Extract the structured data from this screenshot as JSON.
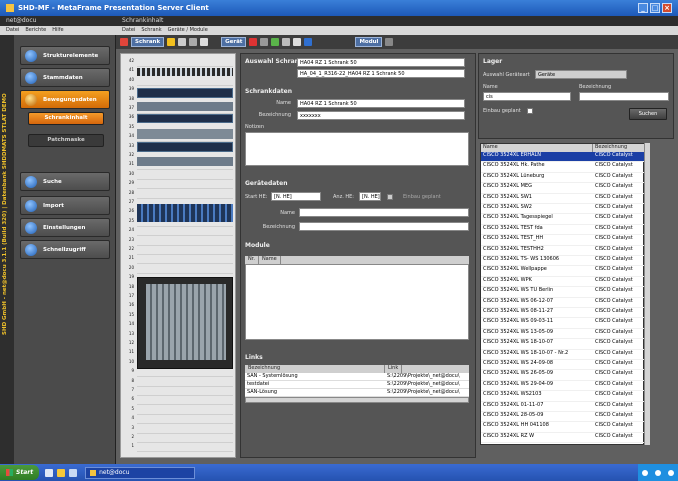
{
  "window": {
    "title": "SHD-MF - MetaFrame Presentation Server Client",
    "left_app_title": "net@docu",
    "left_menu": [
      "Datei",
      "Berichte",
      "Hilfe"
    ],
    "main_title": "Schrankinhalt",
    "main_menu": [
      "Datei",
      "Schrank",
      "Geräte / Module"
    ],
    "vertical_caption": "SHD GmbH - net@docu 3.1.1 (Build 320) | Datenbank SHDDMATS STLAT DEMO"
  },
  "nav": {
    "items": [
      {
        "label": "Strukturelemente",
        "active": false
      },
      {
        "label": "Stammdaten",
        "active": false
      },
      {
        "label": "Bewegungsdaten",
        "active": true
      },
      {
        "label": "Suche",
        "active": false
      },
      {
        "label": "Import",
        "active": false
      },
      {
        "label": "Einstellungen",
        "active": false
      },
      {
        "label": "Schnellzugriff",
        "active": false
      }
    ],
    "sub": [
      {
        "label": "Schrankinhalt",
        "active": true
      },
      {
        "label": "Patchmaske",
        "active": false
      }
    ]
  },
  "toolbar": {
    "tab_schrank": "Schrank",
    "tab_gerat": "Gerät",
    "tab_modul": "Modul"
  },
  "rack": {
    "units": [
      "42",
      "41",
      "40",
      "39",
      "38",
      "37",
      "36",
      "35",
      "34",
      "33",
      "32",
      "31",
      "30",
      "29",
      "28",
      "27",
      "26",
      "25",
      "24",
      "23",
      "22",
      "21",
      "20",
      "19",
      "18",
      "17",
      "16",
      "15",
      "14",
      "13",
      "12",
      "11",
      "10",
      "9",
      "8",
      "7",
      "6",
      "5",
      "4",
      "3",
      "2",
      "1"
    ]
  },
  "form": {
    "auswahl_label": "Auswahl Schrank",
    "auswahl_value1": "HA04 RZ 1 Schrank 50",
    "auswahl_value2": "HA_04_1_R316-22_HA04 RZ 1 Schrank 50",
    "schrankdaten_title": "Schrankdaten",
    "name_label": "Name",
    "name_value": "HA04 RZ 1 Schrank 50",
    "bezeichnung_label": "Bezeichnung",
    "bezeichnung_value": "xxxxxxx",
    "notizen_label": "Notizen",
    "geraetedaten_title": "Gerätedaten",
    "start_he_label": "Start HE:",
    "start_he_value": "[N. HE]",
    "anz_he_label": "Anz. HE:",
    "anz_he_value": "[N. HE]",
    "einbau_label": "Einbau geplant",
    "geraet_name_label": "Name",
    "geraet_bez_label": "Bezeichnung",
    "module_title": "Module",
    "module_cols": [
      "Nr.",
      "Name"
    ],
    "links_title": "Links",
    "links_cols": [
      "Bezeichnung",
      "Link"
    ],
    "links_rows": [
      [
        "SAN - Systemlösung",
        "S:\\2209\\Projekte\\_net@docu\\"
      ],
      [
        "testdatei",
        "S:\\2209\\Projekte\\_net@docu\\"
      ],
      [
        "SAN-Lösung",
        "S:\\2209\\Projekte\\_net@docu\\"
      ]
    ]
  },
  "lager": {
    "title": "Lager",
    "auswahl_label": "Auswahl Geräteart",
    "auswahl_value": "Geräte",
    "name_label": "Name",
    "name_value": "cis",
    "bez_label": "Bezeichnung",
    "einbau_label": "Einbau geplant",
    "suchen_label": "Suchen",
    "cols": [
      "Name",
      "Bezeichnung"
    ],
    "rows": [
      [
        "CISCO 3524XL ERHALN",
        "CISCO Catalyst"
      ],
      [
        "CISCO 3524XL Hk. Pathe",
        "CISCO Catalyst"
      ],
      [
        "CISCO 3524XL Lüneburg",
        "CISCO Catalyst"
      ],
      [
        "CISCO 3524XL MEG",
        "CISCO Catalyst"
      ],
      [
        "CISCO 3524XL SW1",
        "CISCO Catalyst"
      ],
      [
        "CISCO 3524XL SW2",
        "CISCO Catalyst"
      ],
      [
        "CISCO 3524XL Tagesspiegel",
        "CISCO Catalyst"
      ],
      [
        "CISCO 3524XL TEST fda",
        "CISCO Catalyst"
      ],
      [
        "CISCO 3524XL TEST_HH",
        "CISCO Catalyst"
      ],
      [
        "CISCO 3524XL TESTHH2",
        "CISCO Catalyst"
      ],
      [
        "CISCO 3524XL TS- WS 130606",
        "CISCO Catalyst"
      ],
      [
        "CISCO 3524XL Wellpappe",
        "CISCO Catalyst"
      ],
      [
        "CISCO 3524XL WPK",
        "CISCO Catalyst"
      ],
      [
        "CISCO 3524XL WS TU Berlin",
        "CISCO Catalyst"
      ],
      [
        "CISCO 3524XL WS 06-12-07",
        "CISCO Catalyst"
      ],
      [
        "CISCO 3524XL WS 08-11-27",
        "CISCO Catalyst"
      ],
      [
        "CISCO 3524XL WS 09-03-11",
        "CISCO Catalyst"
      ],
      [
        "CISCO 3524XL WS 13-05-09",
        "CISCO Catalyst"
      ],
      [
        "CISCO 3524XL WS 18-10-07",
        "CISCO Catalyst"
      ],
      [
        "CISCO 3524XL WS 18-10-07 - Nr.2",
        "CISCO Catalyst"
      ],
      [
        "CISCO 3524XL WS 24-09-08",
        "CISCO Catalyst"
      ],
      [
        "CISCO 3524XL WS 26-05-09",
        "CISCO Catalyst"
      ],
      [
        "CISCO 3524XL WS 29-04-09",
        "CISCO Catalyst"
      ],
      [
        "CISCO 3524XL WS2103",
        "CISCO Catalyst"
      ],
      [
        "CISCO 3524XL 01-11-07",
        "CISCO Catalyst"
      ],
      [
        "CISCO 3524XL 28-05-09",
        "CISCO Catalyst"
      ],
      [
        "CISCO 3524XL HH 041108",
        "CISCO Catalyst"
      ],
      [
        "CISCO 3524XL RZ W",
        "CISCO Catalyst"
      ]
    ]
  },
  "taskbar": {
    "start": "Start",
    "task": "net@docu"
  },
  "colors": {
    "accent": "#f08a1c",
    "titlebar": "#2a66c6",
    "selection": "#1b3fa5"
  }
}
